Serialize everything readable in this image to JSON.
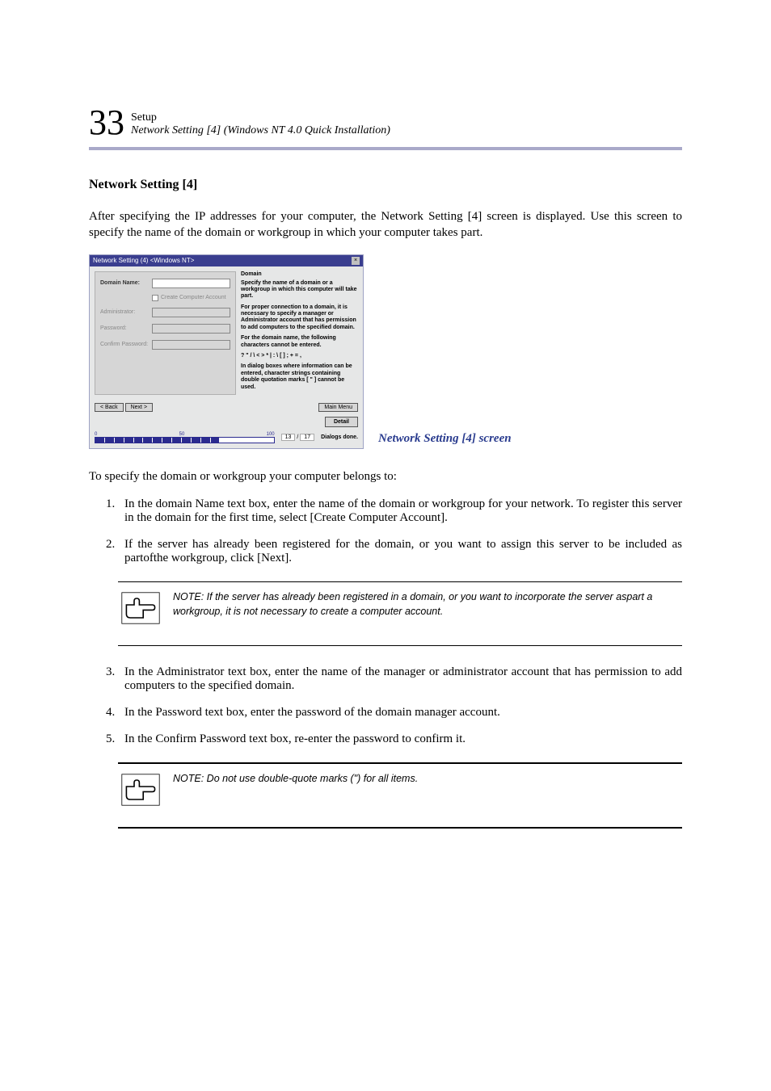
{
  "header": {
    "chapter_number": "33",
    "setup_label": "Setup",
    "subtitle": "Network Setting [4] (Windows NT 4.0 Quick Installation)"
  },
  "section_heading": "Network Setting [4]",
  "intro_para": "After specifying the IP addresses for your computer, the Network Setting [4] screen is displayed. Use this screen to specify the name of the domain or workgroup in which your computer takes part.",
  "screenshot": {
    "title": "Network Setting (4) <Windows NT>",
    "labels": {
      "domain_name": "Domain Name:",
      "create_account": "Create Computer Account",
      "administrator": "Administrator:",
      "password": "Password:",
      "confirm_password": "Confirm Password:"
    },
    "right_panel": {
      "heading": "Domain",
      "p1": "Specify the name of a domain or a workgroup in which this computer will take part.",
      "p2": "For proper connection to a domain, it is necessary to specify a manager or Administrator account that has permission to add computers to the specified domain.",
      "p3": "For the domain name, the following characters cannot be entered.",
      "chars": "? \" / \\ < > * | : \\ [ ] ; + = ,",
      "p4": "In dialog boxes where information can be entered, character strings containing double quotation marks [ \" ] cannot be used."
    },
    "buttons": {
      "back": "< Back",
      "next": "Next >",
      "main_menu": "Main Menu",
      "detail": "Detail"
    },
    "progress": {
      "start": "0",
      "mid": "50",
      "end": "100",
      "current": "13",
      "total": "17",
      "label": "Dialogs done."
    }
  },
  "caption": "Network Setting [4] screen",
  "lead_in": "To specify the domain or workgroup your computer belongs to:",
  "step1": "In the domain Name text box, enter the name of the domain or workgroup for your network. To register this server in the domain for the first time, select [Create Computer Account].",
  "step2": "If the server has already been registered for the domain, or you want to assign this server to be included as partofthe workgroup, click [Next].",
  "note1": "NOTE: If the server has already been registered  in a domain, or you want to incorporate the server aspart a workgroup, it is not necessary to create a computer account.",
  "step3": "In the Administrator text box, enter the name of the manager or administrator account that has permission to add computers to the specified domain.",
  "step4": "In the Password text box, enter the password of the domain manager account.",
  "step5": "In the Confirm Password text box, re-enter the password to confirm it.",
  "note2": "NOTE: Do not use double-quote marks (\") for all items."
}
